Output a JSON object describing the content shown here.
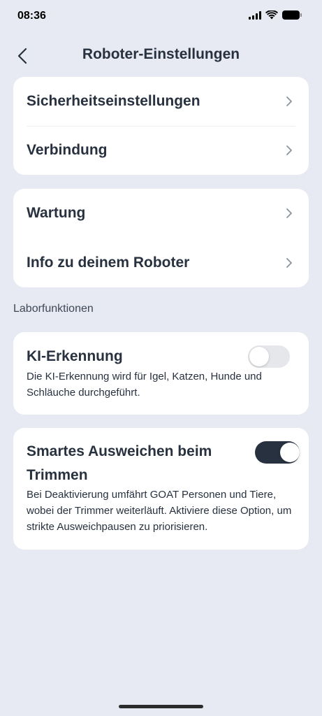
{
  "status_bar": {
    "time": "08:36"
  },
  "header": {
    "title": "Roboter-Einstellungen"
  },
  "group1": {
    "items": [
      {
        "label": "Sicherheitseinstellungen"
      },
      {
        "label": "Verbindung"
      }
    ]
  },
  "group2": {
    "items": [
      {
        "label": "Wartung"
      },
      {
        "label": "Info zu deinem Roboter"
      }
    ]
  },
  "lab_section": {
    "label": "Laborfunktionen"
  },
  "ai_detection": {
    "title": "KI-Erkennung",
    "description": "Die KI-Erkennung wird für Igel, Katzen, Hunde und Schläuche durchgeführt.",
    "enabled": false
  },
  "smart_avoid": {
    "title": "Smartes Ausweichen beim Trimmen",
    "description": "Bei Deaktivierung umfährt GOAT Personen und Tiere, wobei der Trimmer weiterläuft. Aktiviere diese Option, um strikte Ausweichpausen zu priorisieren.",
    "enabled": true
  },
  "colors": {
    "background": "#e7eaf2",
    "card": "#ffffff",
    "text": "#27313f",
    "toggle_on": "#27313f",
    "toggle_off": "#e5e7ea"
  }
}
